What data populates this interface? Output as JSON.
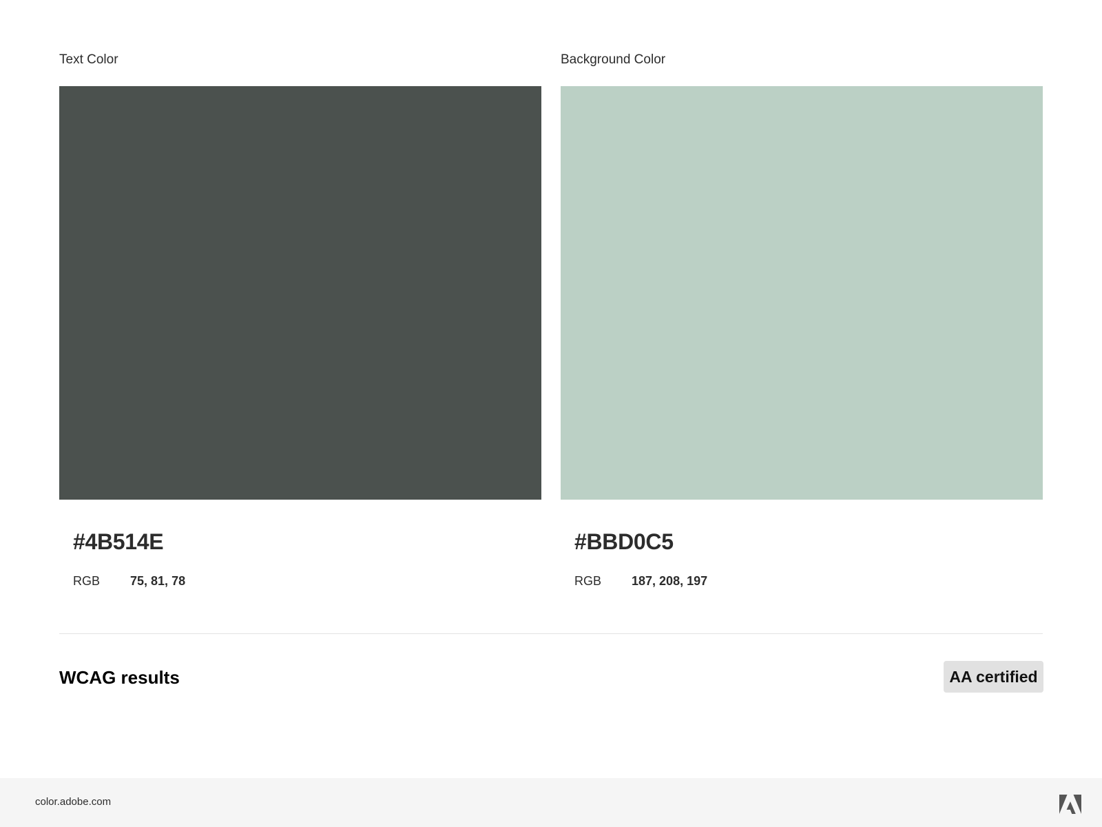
{
  "text_color": {
    "label": "Text Color",
    "hex": "#4B514E",
    "rgb_label": "RGB",
    "rgb_value": "75, 81, 78",
    "swatch_color": "#4B514E"
  },
  "background_color": {
    "label": "Background Color",
    "hex": "#BBD0C5",
    "rgb_label": "RGB",
    "rgb_value": "187, 208, 197",
    "swatch_color": "#BBD0C5"
  },
  "wcag": {
    "title": "WCAG results",
    "badge": "AA certified"
  },
  "footer": {
    "url": "color.adobe.com",
    "logo_icon": "adobe-logo-icon"
  }
}
